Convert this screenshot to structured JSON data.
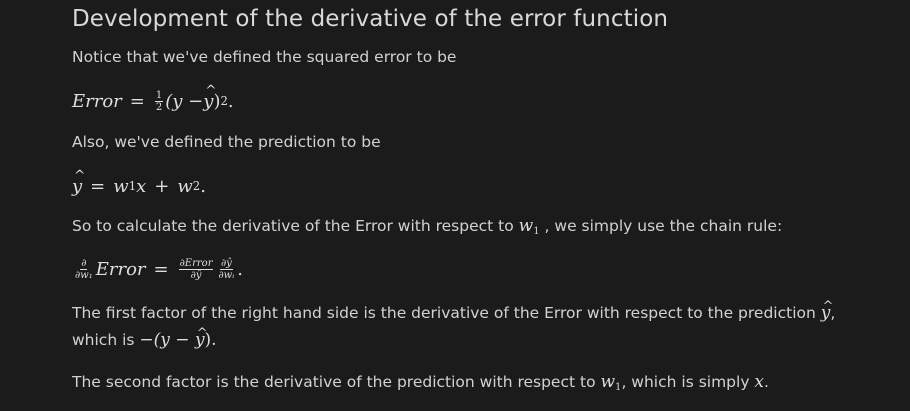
{
  "heading": "Development of the derivative of the error function",
  "p1": "Notice that we've defined the squared error to be",
  "eq1": {
    "lhs": "Error",
    "eq": "=",
    "half_num": "1",
    "half_den": "2",
    "body": "(y − ",
    "yhat": "y",
    "close": ")",
    "power": "2",
    "end": "."
  },
  "p2": "Also, we've defined the prediction to be",
  "eq2": {
    "yhat": "y",
    "eq": "=",
    "w": "w",
    "w1_sub": "1",
    "x": "x",
    "plus": "+",
    "w2": "w",
    "w2_sub": "2",
    "end": "."
  },
  "p3": {
    "before": "So to calculate the derivative of the Error with respect to ",
    "w": "w",
    "w_sub": "1",
    "after": " , we simply use the chain rule:"
  },
  "eq3": {
    "d_num": "∂",
    "d_den": "∂w₁",
    "error": "Error",
    "eq": "=",
    "f1_num": "∂Error",
    "f1_den": "∂ŷ",
    "f2_num": "∂ŷ",
    "f2_den": "∂wᵢ",
    "end": "."
  },
  "p4": {
    "before": "The first factor of the right hand side is the derivative of the Error with respect to the prediction ",
    "yhat": "y",
    "after": ",",
    "line2_before": "which is ",
    "expr": "−(y − ",
    "expr_yhat": "y",
    "expr_end": ").",
    "line2_after": ""
  },
  "p5": {
    "before": "The second factor is the derivative of the prediction with respect to ",
    "w": "w",
    "w_sub": "1",
    "mid": ", which is simply ",
    "x": "x",
    "end": "."
  }
}
